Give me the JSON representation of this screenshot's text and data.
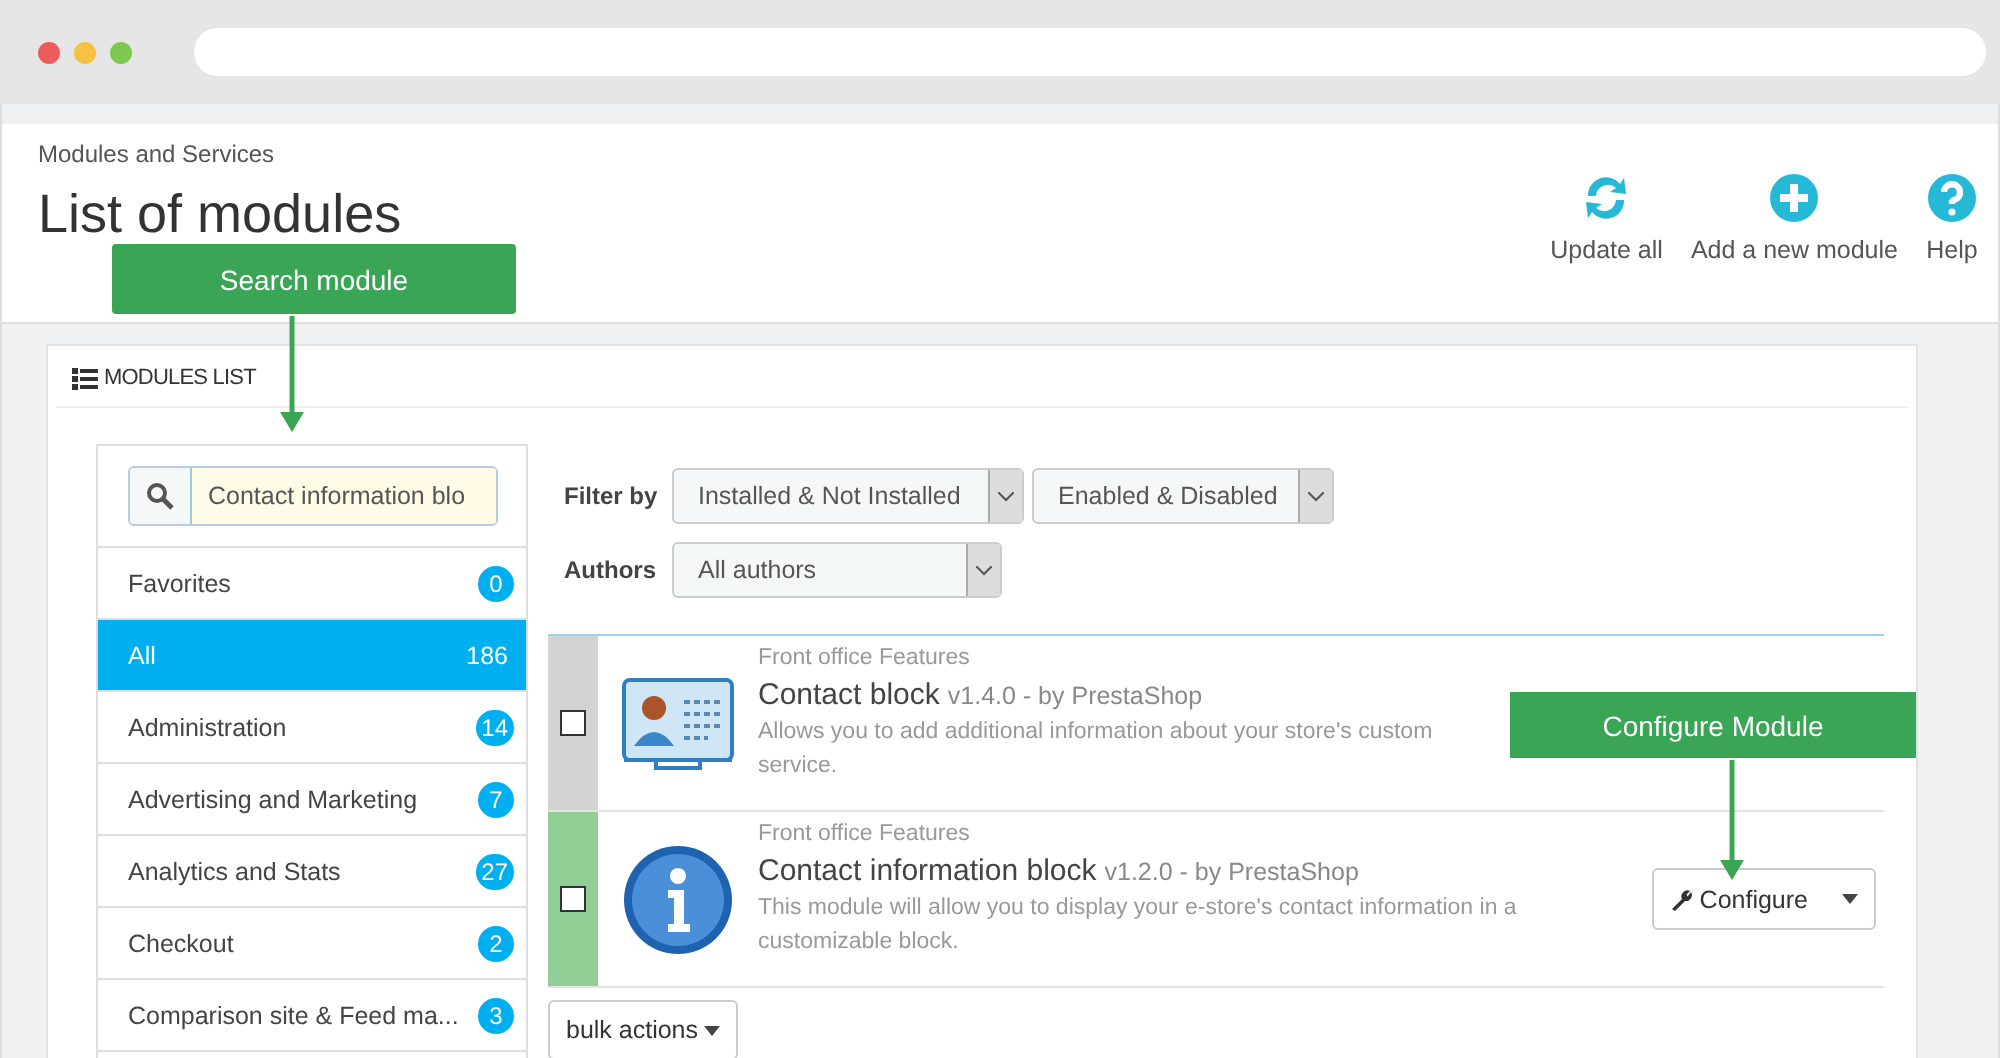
{
  "breadcrumb": "Modules and Services",
  "title": "List of modules",
  "toolbar": [
    {
      "kind": "refresh",
      "label": "Update all"
    },
    {
      "kind": "add",
      "label": "Add a new module"
    },
    {
      "kind": "help",
      "label": "Help"
    }
  ],
  "panel": {
    "heading": "MODULES LIST"
  },
  "search": {
    "value": "Contact information blo"
  },
  "categories": [
    {
      "label": "Favorites",
      "count": "0",
      "selected": false
    },
    {
      "label": "All",
      "count": "186",
      "selected": true
    },
    {
      "label": "Administration",
      "count": "14",
      "selected": false
    },
    {
      "label": "Advertising and Marketing",
      "count": "7",
      "selected": false
    },
    {
      "label": "Analytics and Stats",
      "count": "27",
      "selected": false
    },
    {
      "label": "Checkout",
      "count": "2",
      "selected": false
    },
    {
      "label": "Comparison site & Feed ma...",
      "count": "3",
      "selected": false
    }
  ],
  "filters": {
    "filter_label": "Filter by",
    "install_select": "Installed & Not Installed",
    "enable_select": "Enabled & Disabled",
    "authors_label": "Authors",
    "authors_select": "All authors"
  },
  "modules": [
    {
      "kind": "card",
      "color": "#d3d3d3",
      "checked": false,
      "category": "Front office Features",
      "name": "Contact block",
      "version": "v1.4.0 - by PrestaShop",
      "description": [
        "Allows you to add additional information about your store's custom",
        "service."
      ]
    },
    {
      "kind": "info",
      "color": "#92cf96",
      "checked": false,
      "category": "Front office Features",
      "name": "Contact information block",
      "version": "v1.2.0 - by PrestaShop",
      "description": [
        "This module will allow you to display your e-store's contact information in a",
        "customizable block."
      ],
      "action": "Configure"
    }
  ],
  "bulk_actions": "bulk actions",
  "callouts": [
    {
      "kind": "search",
      "label": "Search module"
    },
    {
      "kind": "configure",
      "label": "Configure Module"
    }
  ]
}
